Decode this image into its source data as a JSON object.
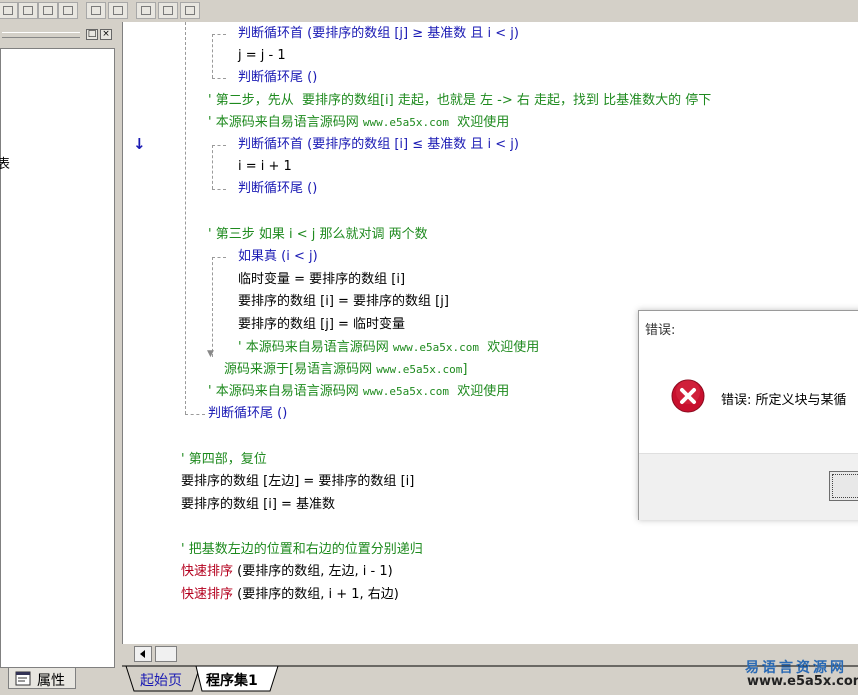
{
  "left_panel": {
    "restore_glyph": "□",
    "close_glyph": "×",
    "cut_text": "表"
  },
  "props_tab": {
    "label": "属性",
    "icon": "properties-icon"
  },
  "gutter": {
    "arrow": "↓",
    "plus": "+"
  },
  "code": [
    {
      "t": "判断循环首 (要排序的数组 [j] ≥ 基准数 且 i < j)",
      "c": "blue"
    },
    {
      "t": "j = j - 1",
      "c": "black"
    },
    {
      "t": "判断循环尾 ()",
      "c": "blue"
    },
    {
      "t": "' 第二步，先从  要排序的数组[i] 走起，也就是 左 -> 右 走起，找到 比基准数大的 停下",
      "c": "green"
    },
    {
      "t": "' 本源码来自易语言源码网 ",
      "c": "green",
      "url": "www.e5a5x.com",
      "tail": "  欢迎使用"
    },
    {
      "t": "判断循环首 (要排序的数组 [i] ≤ 基准数 且 i < j)",
      "c": "blue"
    },
    {
      "t": "i = i + 1",
      "c": "black"
    },
    {
      "t": "判断循环尾 ()",
      "c": "blue"
    },
    {
      "t": "' 第三步 如果 i < j 那么就对调 两个数",
      "c": "green"
    },
    {
      "t": "如果真 (i < j)",
      "c": "blue"
    },
    {
      "t": "临时变量 = 要排序的数组 [i]",
      "c": "black"
    },
    {
      "t": "要排序的数组 [i] = 要排序的数组 [j]",
      "c": "black"
    },
    {
      "t": "要排序的数组 [j] = 临时变量",
      "c": "black"
    },
    {
      "t": "' 本源码来自易语言源码网 ",
      "c": "green",
      "url": "www.e5a5x.com",
      "tail": "  欢迎使用"
    },
    {
      "t": "源码来源于[易语言源码网 ",
      "c": "green",
      "url": "www.e5a5x.com",
      "tail": "]"
    },
    {
      "t": "' 本源码来自易语言源码网 ",
      "c": "green",
      "url": "www.e5a5x.com",
      "tail": "  欢迎使用"
    },
    {
      "t": "判断循环尾 ()",
      "c": "blue"
    },
    {
      "t": "' 第四部，复位",
      "c": "green"
    },
    {
      "t": "要排序的数组 [左边] = 要排序的数组 [i]",
      "c": "black"
    },
    {
      "t": "要排序的数组 [i] = 基准数",
      "c": "black"
    },
    {
      "t": "' 把基数左边的位置和右边的位置分别递归",
      "c": "green"
    },
    {
      "t": "快速排序",
      "c": "red",
      "tail": " (要排序的数组, 左边, i - 1)"
    },
    {
      "t": "快速排序",
      "c": "red",
      "tail": " (要排序的数组, i + 1, 右边)"
    }
  ],
  "tabs": [
    {
      "label": "起始页"
    },
    {
      "label": "程序集1"
    }
  ],
  "watermark": {
    "line1": "易语言资源网",
    "line2": "www.e5a5x.com"
  },
  "dialog": {
    "title": "错误:",
    "message": "错误: 所定义块与某循",
    "icon": "error-icon",
    "button_label": ""
  },
  "colors": {
    "blue": "#1a1ab4",
    "green": "#1e8a1e",
    "red": "#b4001e"
  }
}
